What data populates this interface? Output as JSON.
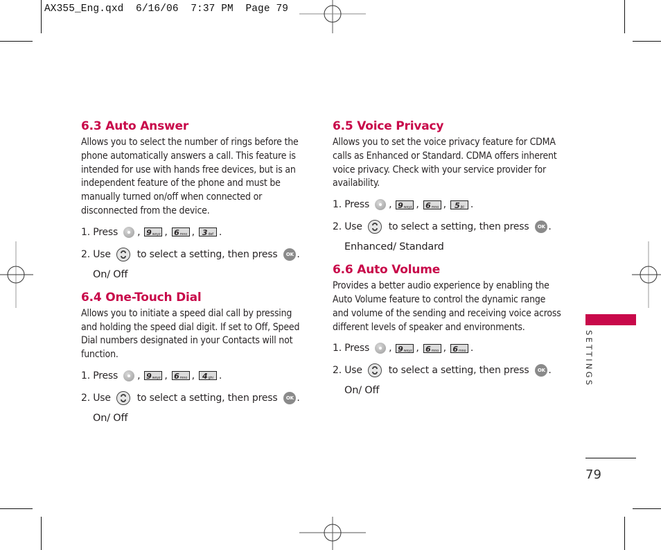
{
  "slug": "AX355_Eng.qxd  6/16/06  7:37 PM  Page 79",
  "section_tab": {
    "label": "SETTINGS",
    "color": "#c8094a"
  },
  "page_number": "79",
  "accent_color": "#c8094a",
  "sections": [
    {
      "title": "6.3 Auto Answer",
      "body": "Allows you to select the number of rings before the phone automatically answers a call. This feature is intended for use with hands free devices, but is an independent feature of the phone and must be manually turned on/off when connected or disconnected from the device.",
      "step1_prefix": "1. Press",
      "keys": [
        {
          "digit": "9",
          "letters": "wxyz"
        },
        {
          "digit": "6",
          "letters": "mno"
        },
        {
          "digit": "3",
          "letters": "def"
        }
      ],
      "step2_prefix": "2. Use",
      "step2_suffix": "to select a setting, then press",
      "ok_label": "OK",
      "options": "On/ Off"
    },
    {
      "title": "6.4 One-Touch Dial",
      "body": "Allows you to initiate a speed dial call by pressing and holding the speed dial digit. If set to Off, Speed Dial numbers designated in your Contacts will not function.",
      "step1_prefix": "1. Press",
      "keys": [
        {
          "digit": "9",
          "letters": "wxyz"
        },
        {
          "digit": "6",
          "letters": "mno"
        },
        {
          "digit": "4",
          "letters": "ghi"
        }
      ],
      "step2_prefix": "2. Use",
      "step2_suffix": "to select a setting, then press",
      "ok_label": "OK",
      "options": "On/ Off"
    },
    {
      "title": "6.5 Voice Privacy",
      "body": "Allows you to set the voice privacy feature for CDMA calls as Enhanced or Standard. CDMA offers inherent voice privacy. Check with your service provider for availability.",
      "step1_prefix": "1. Press",
      "keys": [
        {
          "digit": "9",
          "letters": "wxyz"
        },
        {
          "digit": "6",
          "letters": "mno"
        },
        {
          "digit": "5",
          "letters": "jkl"
        }
      ],
      "step2_prefix": "2. Use",
      "step2_suffix": "to select a setting, then press",
      "ok_label": "OK",
      "options": "Enhanced/ Standard"
    },
    {
      "title": "6.6 Auto Volume",
      "body": "Provides a better audio experience by enabling the Auto Volume feature to control the dynamic range and volume of the sending and receiving voice across different levels of speaker and environments.",
      "step1_prefix": "1. Press",
      "keys": [
        {
          "digit": "9",
          "letters": "wxyz"
        },
        {
          "digit": "6",
          "letters": "mno"
        },
        {
          "digit": "6",
          "letters": "mno"
        }
      ],
      "step2_prefix": "2. Use",
      "step2_suffix": "to select a setting, then press",
      "ok_label": "OK",
      "options": "On/ Off"
    }
  ]
}
